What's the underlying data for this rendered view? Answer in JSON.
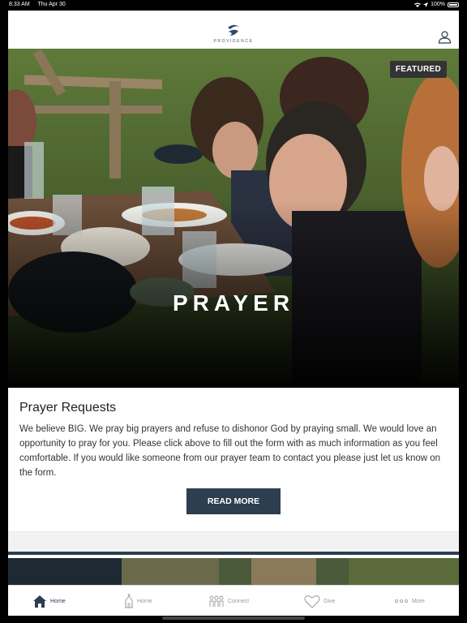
{
  "status_bar": {
    "time": "8:33 AM",
    "date": "Thu Apr 30",
    "battery": "100%"
  },
  "header": {
    "logo_text": "PROVIDENCE"
  },
  "hero": {
    "badge": "FEATURED",
    "title": "PRAYER"
  },
  "card": {
    "title": "Prayer Requests",
    "body": "We believe BIG. We pray big prayers and refuse to dishonor God by praying small. We would love an opportunity to pray for you. Please click above to fill out the form with as much information as you feel comfortable. If you would like someone from our prayer team to contact you please just let us know on the form.",
    "button": "READ MORE"
  },
  "tabbar": {
    "items": [
      {
        "label": "Home",
        "icon": "house-icon",
        "active": true
      },
      {
        "label": "Home",
        "icon": "church-icon",
        "active": false
      },
      {
        "label": "Connect",
        "icon": "people-icon",
        "active": false
      },
      {
        "label": "Give",
        "icon": "heart-icon",
        "active": false
      },
      {
        "label": "More",
        "icon": "dots-icon",
        "active": false
      }
    ]
  },
  "colors": {
    "accent": "#2c3e50",
    "badge_bg": "#333333"
  }
}
